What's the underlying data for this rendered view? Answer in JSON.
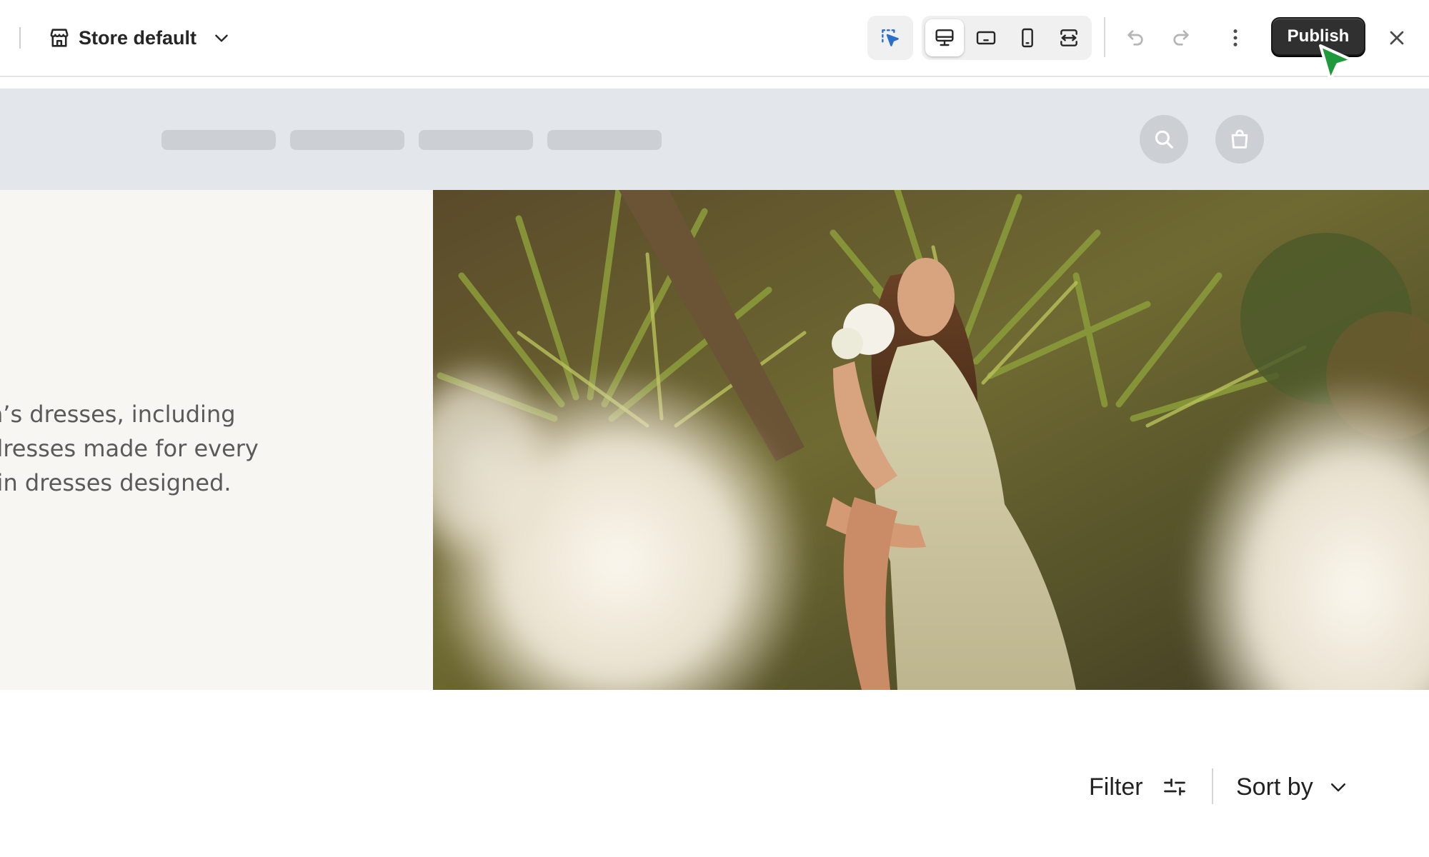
{
  "toolbar": {
    "store_selector": {
      "label": "Store default",
      "icon": "store-icon"
    },
    "select_tool": {
      "icon": "select-element-icon"
    },
    "device_modes": [
      {
        "name": "desktop",
        "icon": "desktop-icon",
        "active": true
      },
      {
        "name": "tablet",
        "icon": "tablet-landscape-icon",
        "active": false
      },
      {
        "name": "mobile",
        "icon": "mobile-icon",
        "active": false
      },
      {
        "name": "full-width",
        "icon": "full-width-icon",
        "active": false
      }
    ],
    "undo": {
      "icon": "undo-icon"
    },
    "redo": {
      "icon": "redo-icon"
    },
    "more": {
      "icon": "more-vertical-icon"
    },
    "publish_label": "Publish",
    "close": {
      "icon": "close-icon"
    }
  },
  "preview": {
    "header": {
      "search": {
        "icon": "search-icon"
      },
      "cart": {
        "icon": "shopping-bag-icon"
      }
    },
    "hero": {
      "text_lines": [
        "n’s dresses, including",
        "dresses made for every",
        "-in dresses designed."
      ],
      "image": "woman in floral dress holding white flowers among palm leaves"
    },
    "filter_label": "Filter",
    "sort_label": "Sort by"
  },
  "colors": {
    "publish_bg": "#303030",
    "accent_blue": "#2c6ecb",
    "cursor_green": "#1f9a3a",
    "preview_header_bg": "#e3e6ea",
    "hero_left_bg": "#f7f6f2"
  }
}
